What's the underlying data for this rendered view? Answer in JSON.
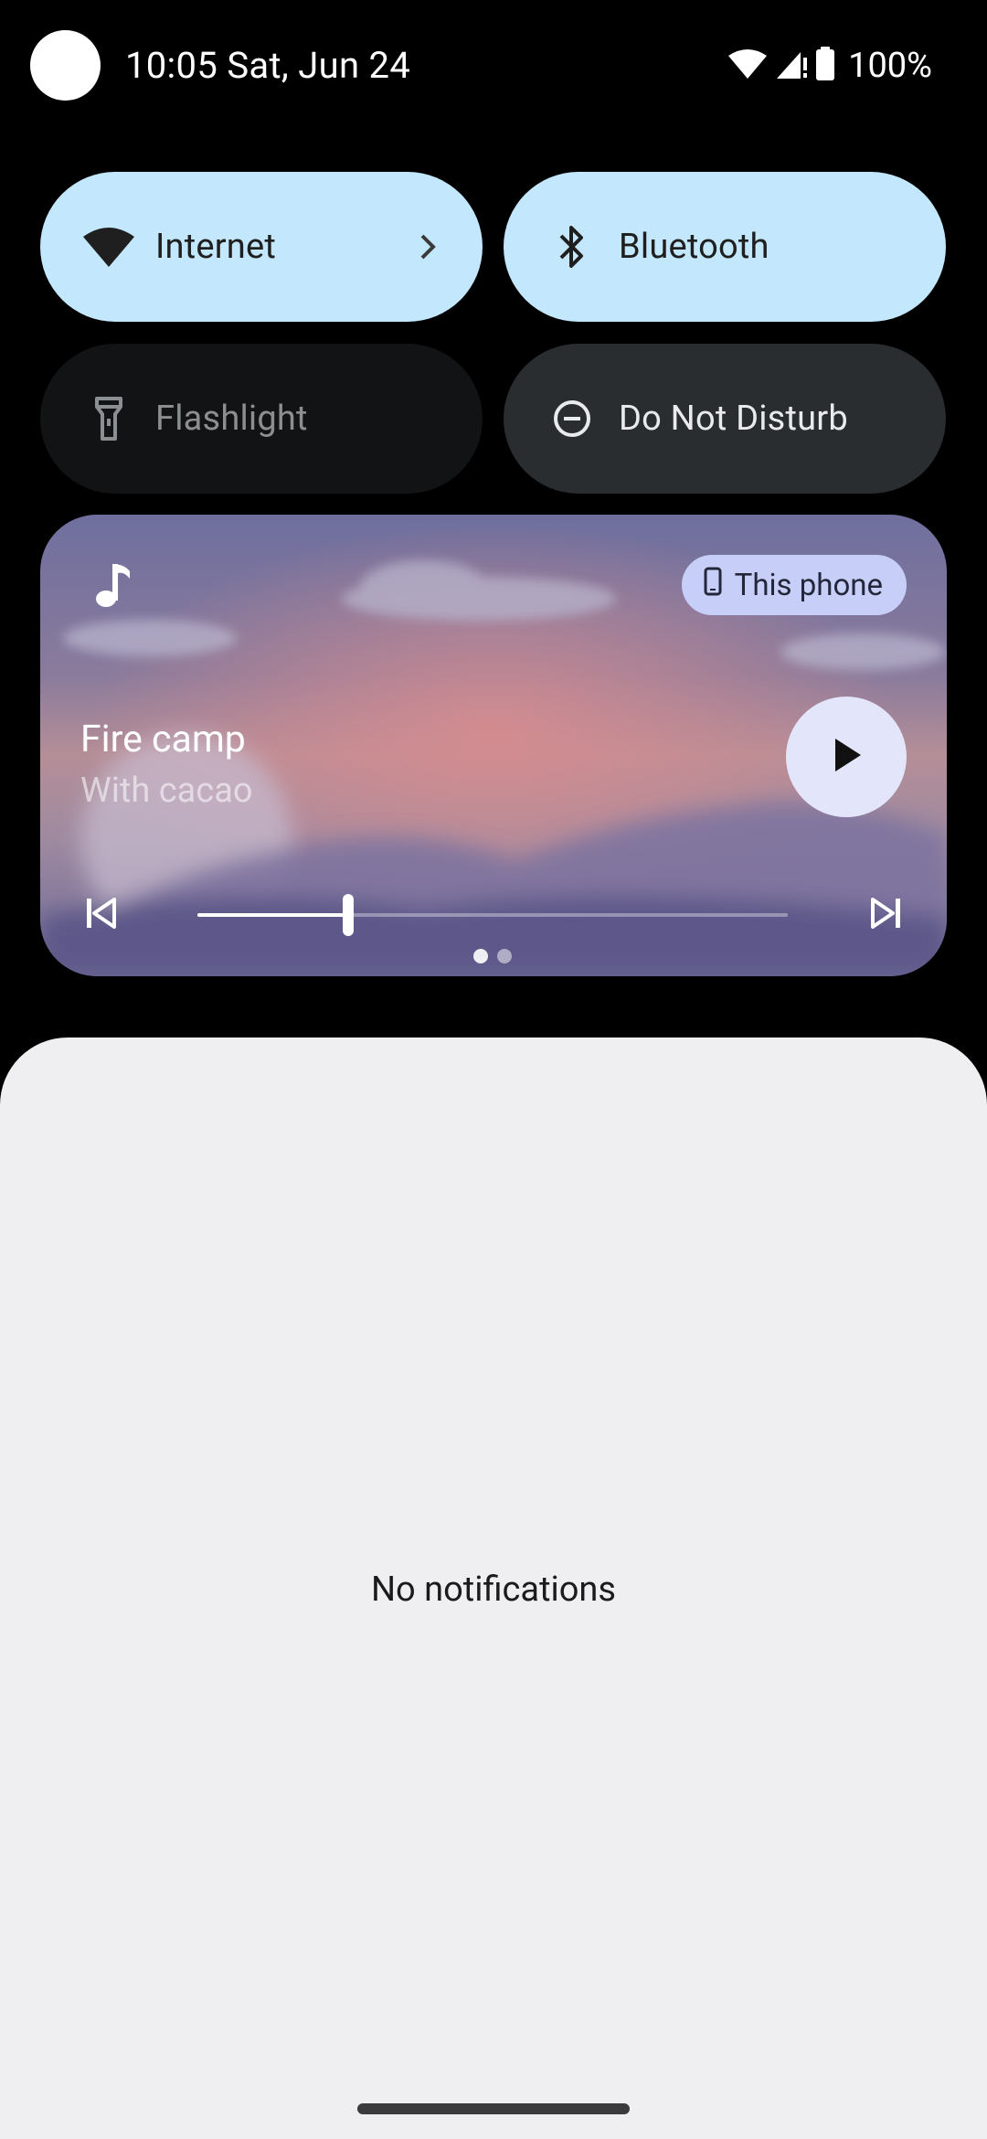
{
  "status_bar": {
    "clock_date": "10:05 Sat, Jun 24",
    "battery_percent": "100%",
    "icons": [
      "wifi-icon",
      "cell-signal-icon",
      "battery-icon"
    ]
  },
  "quick_settings": {
    "tiles": [
      {
        "label": "Internet",
        "icon": "wifi-icon",
        "state": "on",
        "has_chevron": true
      },
      {
        "label": "Bluetooth",
        "icon": "bluetooth-icon",
        "state": "on"
      },
      {
        "label": "Flashlight",
        "icon": "flashlight-icon",
        "state": "unavailable"
      },
      {
        "label": "Do Not Disturb",
        "icon": "do-not-disturb-icon",
        "state": "off"
      }
    ]
  },
  "media": {
    "app_icon": "music-note-icon",
    "output_label": "This phone",
    "output_icon": "phone-icon",
    "title": "Fire camp",
    "artist": "With cacao",
    "progress": 0.255,
    "page_count": 2,
    "current_page": 1
  },
  "notifications": {
    "empty_text": "No notifications"
  },
  "colors": {
    "tile_active": "#c3e7fc",
    "tile_inactive": "#2a2d2f",
    "panel_background": "#efeff2",
    "chip_background": "#c7cff8"
  }
}
